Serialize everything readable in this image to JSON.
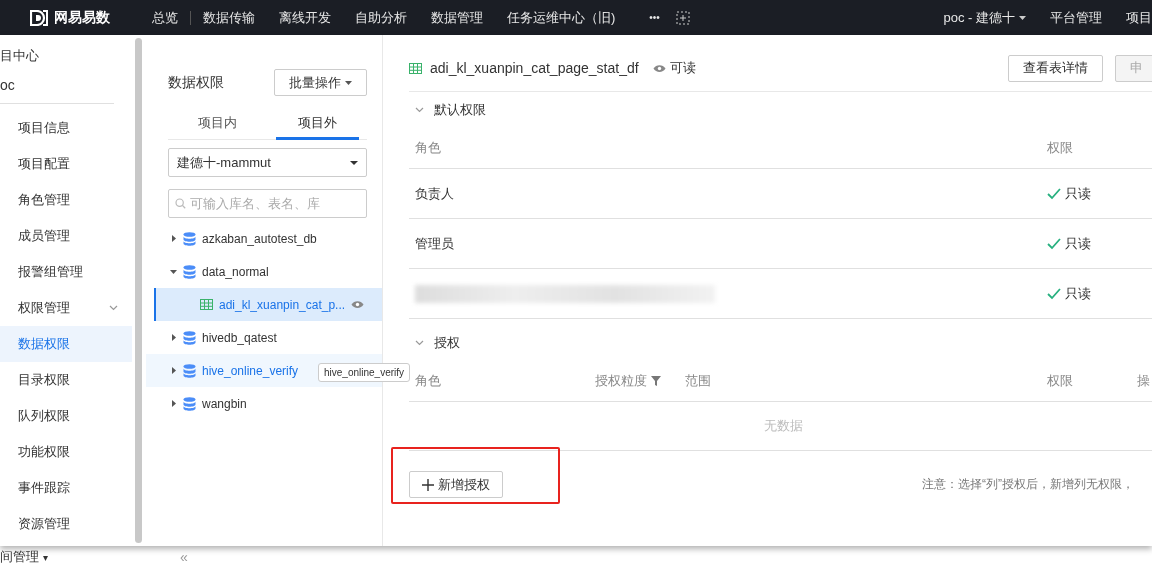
{
  "nav": {
    "logo": "网易易数",
    "items": [
      {
        "label": "总览",
        "selected": false
      },
      {
        "label": "数据传输",
        "selected": false
      },
      {
        "label": "离线开发",
        "selected": false
      },
      {
        "label": "自助分析",
        "selected": false
      },
      {
        "label": "数据管理",
        "selected": false
      },
      {
        "label": "任务运维中心（旧)",
        "selected": false
      }
    ],
    "more": "•••",
    "project": "poc - 建德十",
    "links": [
      "平台管理",
      "项目"
    ]
  },
  "sidebar": {
    "header": "目中心",
    "project": "oc",
    "items": [
      {
        "label": "项目信息",
        "selected": false
      },
      {
        "label": "项目配置",
        "selected": false
      },
      {
        "label": "角色管理",
        "selected": false
      },
      {
        "label": "成员管理",
        "selected": false
      },
      {
        "label": "报警组管理",
        "selected": false
      },
      {
        "label": "权限管理",
        "selected": false,
        "expanded": true,
        "children": [
          {
            "label": "数据权限",
            "selected": true
          },
          {
            "label": "目录权限",
            "selected": false
          },
          {
            "label": "队列权限",
            "selected": false
          },
          {
            "label": "功能权限",
            "selected": false
          }
        ]
      },
      {
        "label": "事件跟踪",
        "selected": false
      },
      {
        "label": "资源管理",
        "selected": false
      }
    ],
    "footer": "间管理",
    "footer_caret": "▾",
    "collapse": "«"
  },
  "tree_panel": {
    "title": "数据权限",
    "batch_button": "批量操作",
    "tabs": [
      {
        "label": "项目内",
        "selected": false
      },
      {
        "label": "项目外",
        "selected": true
      }
    ],
    "project_select": "建德十-mammut",
    "search": {
      "placeholder": "可输入库名、表名、库"
    },
    "nodes": [
      {
        "kind": "database",
        "label": "azkaban_autotest_db",
        "expanded": false,
        "selected": false,
        "hovered": false
      },
      {
        "kind": "database",
        "label": "data_normal",
        "expanded": true,
        "selected": false,
        "hovered": false,
        "children": [
          {
            "kind": "table",
            "label": "adi_kl_xuanpin_cat_p...",
            "selected": true,
            "readable": true
          }
        ]
      },
      {
        "kind": "database",
        "label": "hivedb_qatest",
        "expanded": false,
        "selected": false,
        "hovered": false
      },
      {
        "kind": "database",
        "label": "hive_online_verify",
        "expanded": false,
        "selected": false,
        "hovered": true
      },
      {
        "kind": "database",
        "label": "wangbin",
        "expanded": false,
        "selected": false,
        "hovered": false
      }
    ],
    "tooltip": "hive_online_verify"
  },
  "detail": {
    "table_name": "adi_kl_xuanpin_cat_page_stat_df",
    "access": "可读",
    "buttons": [
      {
        "label": "查看表详情",
        "disabled": false
      },
      {
        "label": "申",
        "disabled": true
      }
    ],
    "default_section": {
      "title": "默认权限",
      "expanded": true,
      "columns": [
        "角色",
        "权限"
      ],
      "rows": [
        {
          "role": "负责人",
          "permission": "只读",
          "redacted": false
        },
        {
          "role": "管理员",
          "permission": "只读",
          "redacted": false
        },
        {
          "permission": "只读",
          "redacted": true
        }
      ]
    },
    "grant_section": {
      "title": "授权",
      "expanded": true,
      "columns": [
        {
          "label": "角色",
          "filter": false
        },
        {
          "label": "授权粒度",
          "filter": true
        },
        {
          "label": "范围",
          "filter": false
        },
        {
          "label": "权限",
          "filter": false
        },
        {
          "label": "操",
          "filter": false
        }
      ],
      "empty": "无数据",
      "add_button": "新增授权",
      "highlighted": true,
      "note": "注意：选择“列”授权后，新增列无权限，"
    }
  }
}
